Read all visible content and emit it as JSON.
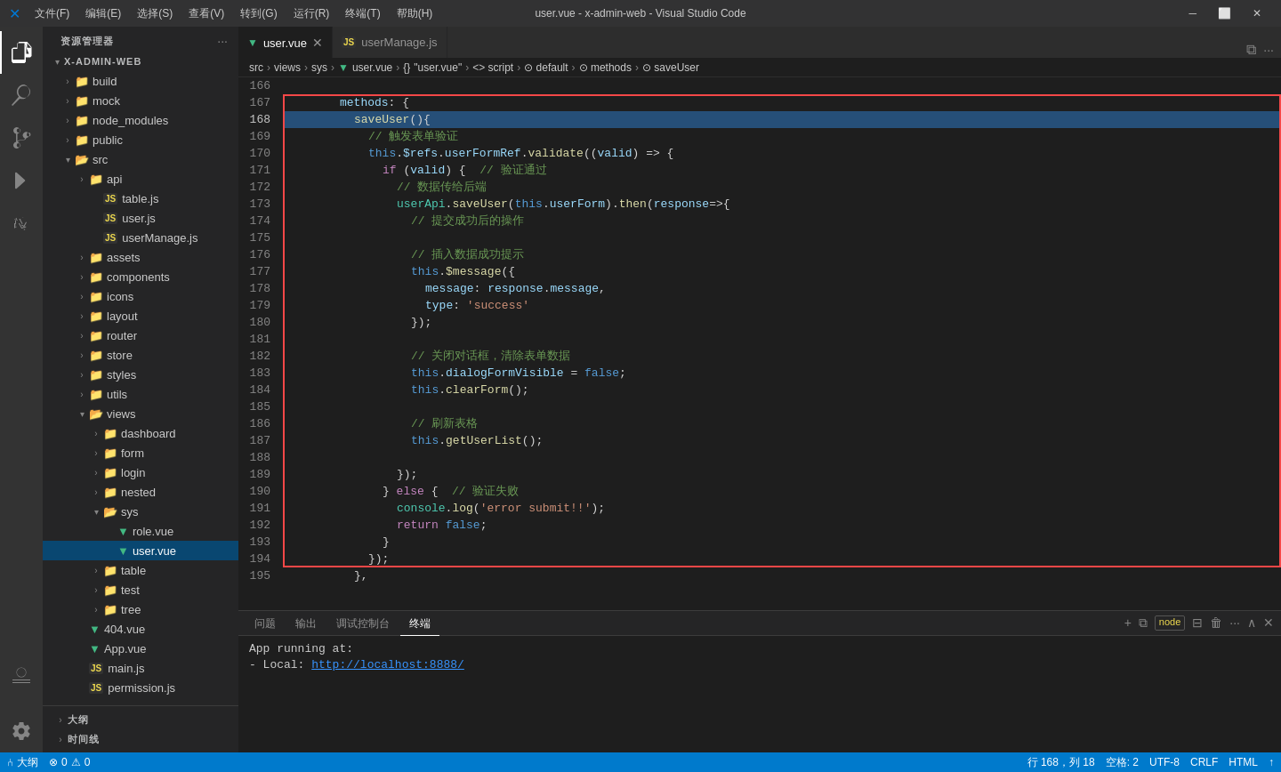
{
  "titlebar": {
    "icon": "⬡",
    "menus": [
      "文件(F)",
      "编辑(E)",
      "选择(S)",
      "查看(V)",
      "转到(G)",
      "运行(R)",
      "终端(T)",
      "帮助(H)"
    ],
    "title": "user.vue - x-admin-web - Visual Studio Code",
    "controls": [
      "⬜",
      "❐",
      "✕"
    ]
  },
  "tabs": [
    {
      "label": "user.vue",
      "type": "vue",
      "active": true
    },
    {
      "label": "userManage.js",
      "type": "js",
      "active": false
    }
  ],
  "breadcrumb": [
    "src",
    ">",
    "views",
    ">",
    "sys",
    ">",
    "user.vue",
    ">",
    "{}",
    "\"user.vue\"",
    ">",
    "⟨⟩",
    "script",
    ">",
    "⊙",
    "default",
    ">",
    "⊙",
    "methods",
    ">",
    "⊙",
    "saveUser"
  ],
  "sidebar": {
    "title": "资源管理器",
    "root": "X-ADMIN-WEB",
    "items": [
      {
        "indent": 0,
        "type": "folder",
        "label": "build",
        "open": false
      },
      {
        "indent": 0,
        "type": "folder",
        "label": "mock",
        "open": false
      },
      {
        "indent": 0,
        "type": "folder",
        "label": "node_modules",
        "open": false
      },
      {
        "indent": 0,
        "type": "folder",
        "label": "public",
        "open": false
      },
      {
        "indent": 0,
        "type": "folder",
        "label": "src",
        "open": true
      },
      {
        "indent": 1,
        "type": "folder",
        "label": "api",
        "open": false
      },
      {
        "indent": 2,
        "type": "js",
        "label": "table.js"
      },
      {
        "indent": 2,
        "type": "js",
        "label": "user.js"
      },
      {
        "indent": 2,
        "type": "js",
        "label": "userManage.js"
      },
      {
        "indent": 1,
        "type": "folder",
        "label": "assets",
        "open": false
      },
      {
        "indent": 1,
        "type": "folder",
        "label": "components",
        "open": false
      },
      {
        "indent": 1,
        "type": "folder",
        "label": "icons",
        "open": false
      },
      {
        "indent": 1,
        "type": "folder",
        "label": "layout",
        "open": false
      },
      {
        "indent": 1,
        "type": "folder",
        "label": "router",
        "open": false
      },
      {
        "indent": 1,
        "type": "folder",
        "label": "store",
        "open": false
      },
      {
        "indent": 1,
        "type": "folder",
        "label": "styles",
        "open": false
      },
      {
        "indent": 1,
        "type": "folder",
        "label": "utils",
        "open": false
      },
      {
        "indent": 1,
        "type": "folder",
        "label": "views",
        "open": true
      },
      {
        "indent": 2,
        "type": "folder",
        "label": "dashboard",
        "open": false
      },
      {
        "indent": 2,
        "type": "folder",
        "label": "form",
        "open": false
      },
      {
        "indent": 2,
        "type": "folder",
        "label": "login",
        "open": false
      },
      {
        "indent": 2,
        "type": "folder",
        "label": "nested",
        "open": false
      },
      {
        "indent": 2,
        "type": "folder",
        "label": "sys",
        "open": true
      },
      {
        "indent": 3,
        "type": "vue",
        "label": "role.vue"
      },
      {
        "indent": 3,
        "type": "vue",
        "label": "user.vue",
        "active": true
      },
      {
        "indent": 2,
        "type": "folder",
        "label": "table",
        "open": false
      },
      {
        "indent": 2,
        "type": "folder",
        "label": "test",
        "open": false
      },
      {
        "indent": 2,
        "type": "folder",
        "label": "tree",
        "open": false
      },
      {
        "indent": 1,
        "type": "vue",
        "label": "404.vue"
      },
      {
        "indent": 1,
        "type": "vue",
        "label": "App.vue"
      },
      {
        "indent": 1,
        "type": "js",
        "label": "main.js"
      },
      {
        "indent": 1,
        "type": "js",
        "label": "permission.js"
      }
    ]
  },
  "code": {
    "lines": [
      {
        "num": 166,
        "content": ""
      },
      {
        "num": 167,
        "tokens": [
          {
            "t": "sp16"
          },
          {
            "t": "kw",
            "v": "methods"
          },
          {
            "t": "op",
            "v": ": {"
          }
        ]
      },
      {
        "num": 168,
        "tokens": [
          {
            "t": "sp20"
          },
          {
            "t": "fn",
            "v": "saveUser"
          },
          {
            "t": "op",
            "v": "(){"
          }
        ],
        "highlight": true
      },
      {
        "num": 169,
        "tokens": [
          {
            "t": "sp24"
          },
          {
            "t": "comment",
            "v": "// 触发表单验证"
          }
        ]
      },
      {
        "num": 170,
        "tokens": [
          {
            "t": "sp24"
          },
          {
            "t": "this-kw",
            "v": "this"
          },
          {
            "t": "op",
            "v": "."
          },
          {
            "t": "prop",
            "v": "$refs"
          },
          {
            "t": "op",
            "v": "."
          },
          {
            "t": "prop",
            "v": "userFormRef"
          },
          {
            "t": "op",
            "v": "."
          },
          {
            "t": "fn",
            "v": "validate"
          },
          {
            "t": "op",
            "v": "(("
          },
          {
            "t": "prop",
            "v": "valid"
          },
          {
            "t": "op",
            "v": ") => {"
          }
        ]
      },
      {
        "num": 171,
        "tokens": [
          {
            "t": "sp28"
          },
          {
            "t": "kw",
            "v": "if"
          },
          {
            "t": "op",
            "v": " ("
          },
          {
            "t": "prop",
            "v": "valid"
          },
          {
            "t": "op",
            "v": ") {  "
          },
          {
            "t": "comment",
            "v": "// 验证通过"
          }
        ]
      },
      {
        "num": 172,
        "tokens": [
          {
            "t": "sp32"
          },
          {
            "t": "comment",
            "v": "// 数据传给后端"
          }
        ]
      },
      {
        "num": 173,
        "tokens": [
          {
            "t": "sp32"
          },
          {
            "t": "type",
            "v": "userApi"
          },
          {
            "t": "op",
            "v": "."
          },
          {
            "t": "fn",
            "v": "saveUser"
          },
          {
            "t": "op",
            "v": "("
          },
          {
            "t": "this-kw",
            "v": "this"
          },
          {
            "t": "op",
            "v": "."
          },
          {
            "t": "prop",
            "v": "userForm"
          },
          {
            "t": "op",
            "v": ")."
          },
          {
            "t": "fn",
            "v": "then"
          },
          {
            "t": "op",
            "v": "("
          },
          {
            "t": "prop",
            "v": "response"
          },
          {
            "t": "op",
            "v": "=>{"
          }
        ]
      },
      {
        "num": 174,
        "tokens": [
          {
            "t": "sp36"
          },
          {
            "t": "comment",
            "v": "// 提交成功后的操作"
          }
        ]
      },
      {
        "num": 175,
        "tokens": []
      },
      {
        "num": 176,
        "tokens": [
          {
            "t": "sp36"
          },
          {
            "t": "comment",
            "v": "// 插入数据成功提示"
          }
        ]
      },
      {
        "num": 177,
        "tokens": [
          {
            "t": "sp36"
          },
          {
            "t": "this-kw",
            "v": "this"
          },
          {
            "t": "op",
            "v": "."
          },
          {
            "t": "fn",
            "v": "$message"
          },
          {
            "t": "op",
            "v": "({"
          }
        ]
      },
      {
        "num": 178,
        "tokens": [
          {
            "t": "sp40"
          },
          {
            "t": "prop",
            "v": "message"
          },
          {
            "t": "op",
            "v": ": "
          },
          {
            "t": "prop",
            "v": "response"
          },
          {
            "t": "op",
            "v": "."
          },
          {
            "t": "prop",
            "v": "message"
          },
          {
            "t": "op",
            "v": ","
          }
        ]
      },
      {
        "num": 179,
        "tokens": [
          {
            "t": "sp40"
          },
          {
            "t": "prop",
            "v": "type"
          },
          {
            "t": "op",
            "v": ": "
          },
          {
            "t": "str",
            "v": "'success'"
          }
        ]
      },
      {
        "num": 180,
        "tokens": [
          {
            "t": "sp36"
          },
          {
            "t": "op",
            "v": "});"
          }
        ]
      },
      {
        "num": 181,
        "tokens": []
      },
      {
        "num": 182,
        "tokens": [
          {
            "t": "sp36"
          },
          {
            "t": "comment",
            "v": "// 关闭对话框，清除表单数据"
          }
        ]
      },
      {
        "num": 183,
        "tokens": [
          {
            "t": "sp36"
          },
          {
            "t": "this-kw",
            "v": "this"
          },
          {
            "t": "op",
            "v": "."
          },
          {
            "t": "prop",
            "v": "dialogFormVisible"
          },
          {
            "t": "op",
            "v": " = "
          },
          {
            "t": "kw",
            "v": "false"
          },
          {
            "t": "op",
            "v": ";"
          }
        ]
      },
      {
        "num": 184,
        "tokens": [
          {
            "t": "sp36"
          },
          {
            "t": "this-kw",
            "v": "this"
          },
          {
            "t": "op",
            "v": "."
          },
          {
            "t": "fn",
            "v": "clearForm"
          },
          {
            "t": "op",
            "v": "();"
          }
        ]
      },
      {
        "num": 185,
        "tokens": []
      },
      {
        "num": 186,
        "tokens": [
          {
            "t": "sp36"
          },
          {
            "t": "comment",
            "v": "// 刷新表格"
          }
        ]
      },
      {
        "num": 187,
        "tokens": [
          {
            "t": "sp36"
          },
          {
            "t": "this-kw",
            "v": "this"
          },
          {
            "t": "op",
            "v": "."
          },
          {
            "t": "fn",
            "v": "getUserList"
          },
          {
            "t": "op",
            "v": "();"
          }
        ]
      },
      {
        "num": 188,
        "tokens": []
      },
      {
        "num": 189,
        "tokens": [
          {
            "t": "sp32"
          },
          {
            "t": "op",
            "v": "});"
          }
        ]
      },
      {
        "num": 190,
        "tokens": [
          {
            "t": "sp28"
          },
          {
            "t": "op",
            "v": "} "
          },
          {
            "t": "kw",
            "v": "else"
          },
          {
            "t": "op",
            "v": " {  "
          },
          {
            "t": "comment",
            "v": "// 验证失败"
          }
        ]
      },
      {
        "num": 191,
        "tokens": [
          {
            "t": "sp32"
          },
          {
            "t": "type",
            "v": "console"
          },
          {
            "t": "op",
            "v": "."
          },
          {
            "t": "fn",
            "v": "log"
          },
          {
            "t": "op",
            "v": "("
          },
          {
            "t": "str",
            "v": "'error submit!!'"
          },
          {
            "t": "op",
            "v": ");"
          }
        ]
      },
      {
        "num": 192,
        "tokens": [
          {
            "t": "sp32"
          },
          {
            "t": "kw",
            "v": "return"
          },
          {
            "t": "op",
            "v": " "
          },
          {
            "t": "kw",
            "v": "false"
          },
          {
            "t": "op",
            "v": ";"
          }
        ]
      },
      {
        "num": 193,
        "tokens": [
          {
            "t": "sp28"
          },
          {
            "t": "op",
            "v": "}"
          }
        ]
      },
      {
        "num": 194,
        "tokens": [
          {
            "t": "sp24"
          },
          {
            "t": "op",
            "v": "});"
          }
        ]
      },
      {
        "num": 195,
        "tokens": [
          {
            "t": "sp20"
          },
          {
            "t": "op",
            "v": "},"
          }
        ]
      }
    ]
  },
  "terminal": {
    "tabs": [
      "问题",
      "输出",
      "调试控制台",
      "终端"
    ],
    "active_tab": "终端",
    "content": [
      "App running at:",
      "  - Local:    http://localhost:8888/"
    ],
    "node_label": "node"
  },
  "statusbar": {
    "left": [
      "⑃ 0",
      "⚠ 0"
    ],
    "position": "行 168，列 18",
    "spaces": "空格: 2",
    "encoding": "UTF-8",
    "line_ending": "CRLF",
    "language": "HTML",
    "sync": "↑"
  },
  "icons": {
    "explorer": "⊞",
    "search": "🔍",
    "git": "⑃",
    "debug": "▷",
    "extensions": "⊡",
    "settings": "⚙",
    "account": "👤"
  }
}
